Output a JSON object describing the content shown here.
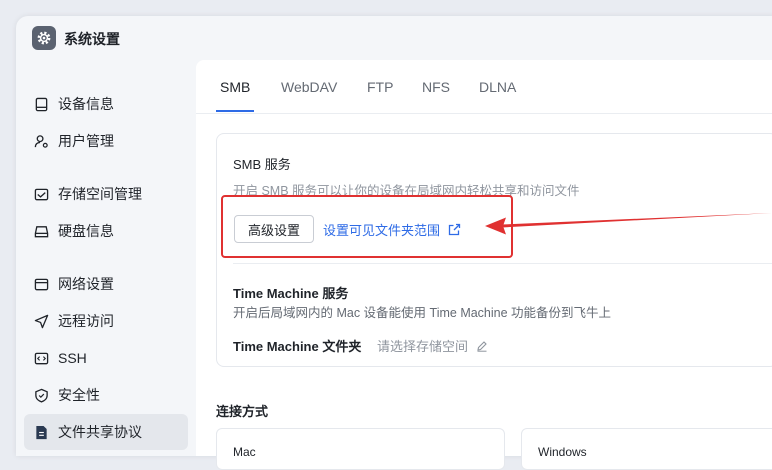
{
  "window": {
    "title": "系统设置",
    "app_icon": "gear-icon"
  },
  "sidebar": {
    "items": [
      {
        "label": "设备信息",
        "icon": "device-icon",
        "active": false
      },
      {
        "label": "用户管理",
        "icon": "user-settings-icon",
        "active": false
      },
      {
        "label": "存储空间管理",
        "icon": "storage-icon",
        "active": false
      },
      {
        "label": "硬盘信息",
        "icon": "disk-icon",
        "active": false
      },
      {
        "label": "网络设置",
        "icon": "network-icon",
        "active": false
      },
      {
        "label": "远程访问",
        "icon": "send-icon",
        "active": false
      },
      {
        "label": "SSH",
        "icon": "code-icon",
        "active": false
      },
      {
        "label": "安全性",
        "icon": "shield-icon",
        "active": false
      },
      {
        "label": "文件共享协议",
        "icon": "file-icon",
        "active": true
      }
    ]
  },
  "tabs": [
    {
      "label": "SMB",
      "active": true
    },
    {
      "label": "WebDAV",
      "active": false
    },
    {
      "label": "FTP",
      "active": false
    },
    {
      "label": "NFS",
      "active": false
    },
    {
      "label": "DLNA",
      "active": false
    }
  ],
  "smb": {
    "title": "SMB 服务",
    "description": "开启 SMB 服务可以让你的设备在局域网内轻松共享和访问文件",
    "advanced_button": "高级设置",
    "visibility_link": "设置可见文件夹范围"
  },
  "time_machine": {
    "title": "Time Machine 服务",
    "description": "开启后局域网内的 Mac 设备能使用 Time Machine 功能备份到飞牛上",
    "folder_label": "Time Machine 文件夹",
    "folder_value": "请选择存储空间"
  },
  "connection": {
    "title": "连接方式",
    "options": [
      "Mac",
      "Windows"
    ]
  },
  "colors": {
    "accent": "#2e6be6",
    "annotation": "#e03131"
  }
}
